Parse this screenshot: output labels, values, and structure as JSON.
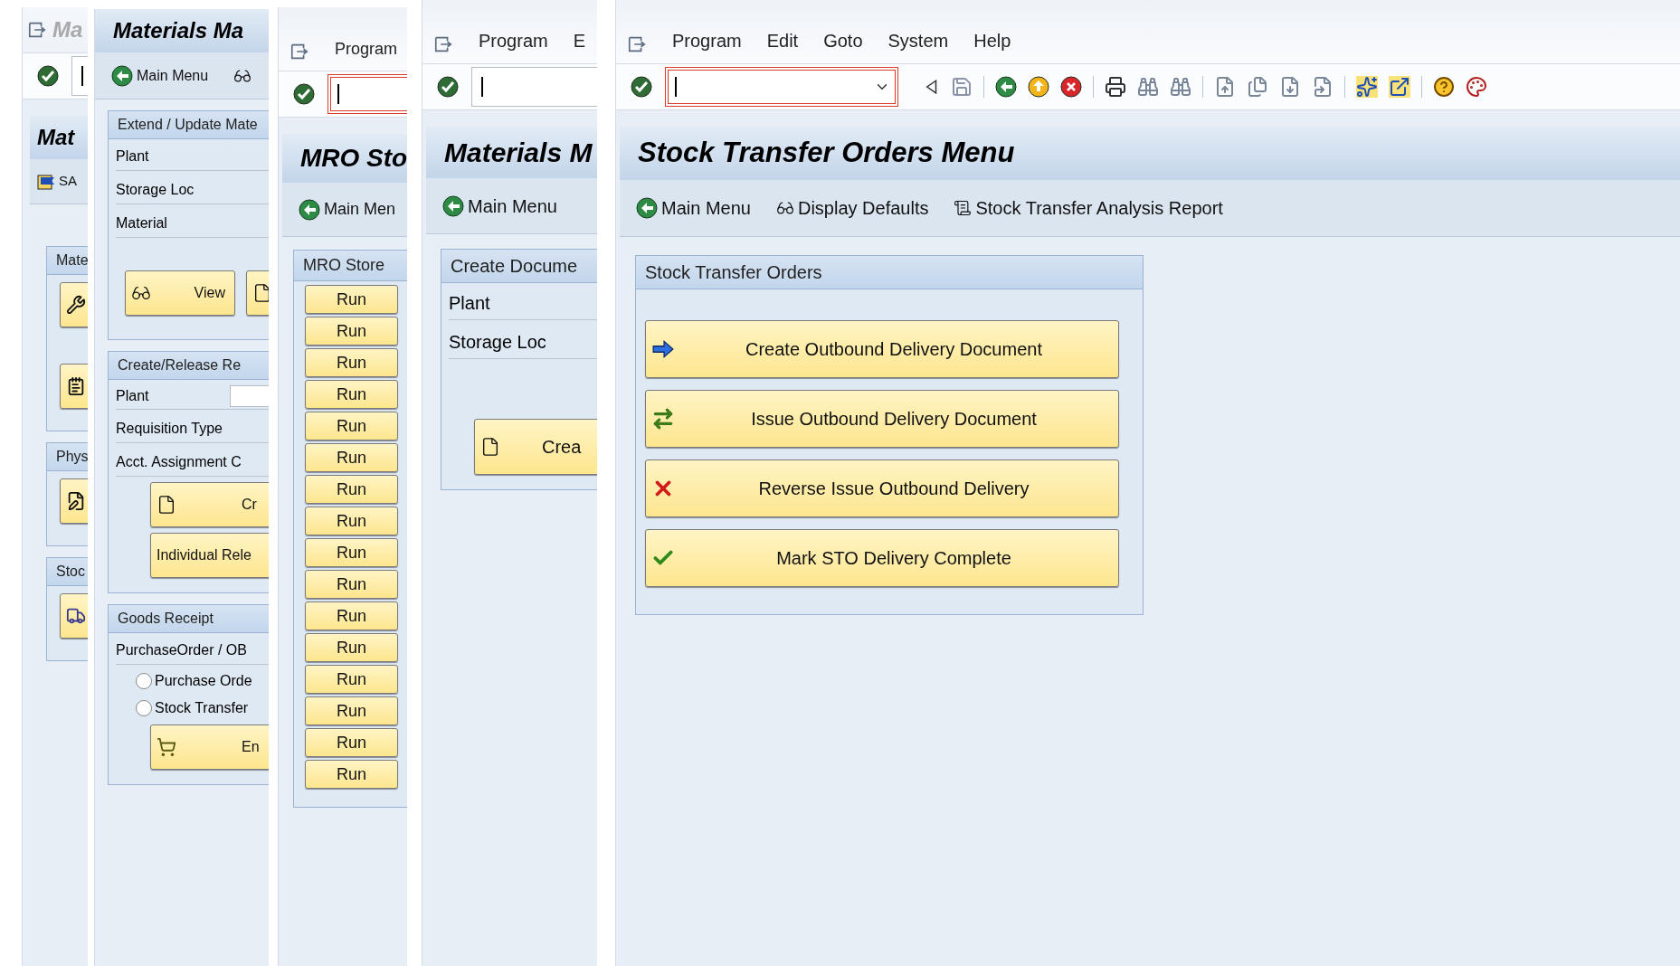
{
  "windows": [
    {
      "header_title": "Ma",
      "command_field": {
        "focused": false
      },
      "title": "Mat",
      "app_toolbar": [
        {
          "kind": "text",
          "label": "SA"
        }
      ],
      "groups": [
        {
          "title": "Mate",
          "items": [
            {
              "kind": "icon_button"
            },
            {
              "kind": "icon_button"
            }
          ]
        },
        {
          "title": "Phys",
          "items": [
            {
              "kind": "icon_button"
            }
          ]
        },
        {
          "title": "Stoc",
          "items": [
            {
              "kind": "icon_button"
            }
          ]
        }
      ]
    },
    {
      "title": "Materials Ma",
      "app_toolbar": [
        {
          "kind": "text",
          "label": "Main Menu"
        },
        {
          "kind": "icon"
        }
      ],
      "groups": [
        {
          "title": "Extend / Update Mate",
          "items": [
            {
              "kind": "label_row",
              "label": "Plant"
            },
            {
              "kind": "label_row",
              "label": "Storage Loc"
            },
            {
              "kind": "label_row",
              "label": "Material"
            },
            {
              "kind": "button_row",
              "buttons": [
                {
                  "kind": "text",
                  "label": "View"
                },
                {
                  "kind": "icon"
                }
              ]
            }
          ]
        },
        {
          "title": "Create/Release Re",
          "items": [
            {
              "kind": "input_row",
              "label": "Plant"
            },
            {
              "kind": "label_row",
              "label": "Requisition Type"
            },
            {
              "kind": "label_row",
              "label": "Acct. Assignment C"
            },
            {
              "kind": "button",
              "label": "Cr"
            },
            {
              "kind": "button",
              "label": "Individual Rele"
            }
          ]
        },
        {
          "title": "Goods Receipt",
          "items": [
            {
              "kind": "label_row",
              "label": "PurchaseOrder / OB"
            },
            {
              "kind": "radio",
              "label": "Purchase Orde",
              "selected": false
            },
            {
              "kind": "radio",
              "label": "Stock Transfer",
              "selected": false
            },
            {
              "kind": "button",
              "label": "En"
            }
          ]
        }
      ]
    },
    {
      "menu": [
        "Program"
      ],
      "command_field": {
        "focused": true
      },
      "title": "MRO Sto",
      "app_toolbar": [
        {
          "kind": "text",
          "label": "Main Men"
        }
      ],
      "groups": [
        {
          "title": "MRO Store",
          "items": [
            {
              "kind": "button",
              "label": "Run"
            },
            {
              "kind": "button",
              "label": "Run"
            },
            {
              "kind": "button",
              "label": "Run"
            },
            {
              "kind": "button",
              "label": "Run"
            },
            {
              "kind": "button",
              "label": "Run"
            },
            {
              "kind": "button",
              "label": "Run"
            },
            {
              "kind": "button",
              "label": "Run"
            },
            {
              "kind": "button",
              "label": "Run"
            },
            {
              "kind": "button",
              "label": "Run"
            },
            {
              "kind": "button",
              "label": "Run"
            },
            {
              "kind": "button",
              "label": "Run"
            },
            {
              "kind": "button",
              "label": "Run"
            },
            {
              "kind": "button",
              "label": "Run"
            },
            {
              "kind": "button",
              "label": "Run"
            },
            {
              "kind": "button",
              "label": "Run"
            },
            {
              "kind": "button",
              "label": "Run"
            }
          ]
        }
      ]
    },
    {
      "menu": [
        "Program",
        "E"
      ],
      "command_field": {
        "focused": false
      },
      "title": "Materials M",
      "app_toolbar": [
        {
          "kind": "text",
          "label": "Main Menu"
        }
      ],
      "groups": [
        {
          "title": "Create Docume",
          "items": [
            {
              "kind": "label_row",
              "label": "Plant"
            },
            {
              "kind": "label_row",
              "label": "Storage Loc"
            },
            {
              "kind": "button",
              "label": "Crea"
            }
          ]
        }
      ]
    },
    {
      "menu": [
        "Program",
        "Edit",
        "Goto",
        "System",
        "Help"
      ],
      "command_field": {
        "focused": true
      },
      "title": "Stock Transfer Orders Menu",
      "app_toolbar": [
        {
          "kind": "text",
          "label": "Main Menu"
        },
        {
          "kind": "text",
          "label": "Display Defaults"
        },
        {
          "kind": "text",
          "label": "Stock Transfer Analysis Report"
        }
      ],
      "groups": [
        {
          "title": "Stock Transfer Orders",
          "items": [
            {
              "kind": "button",
              "label": "Create Outbound Delivery Document"
            },
            {
              "kind": "button",
              "label": "Issue Outbound Delivery Document"
            },
            {
              "kind": "button",
              "label": "Reverse Issue Outbound Delivery"
            },
            {
              "kind": "button",
              "label": "Mark STO Delivery Complete"
            }
          ]
        }
      ]
    }
  ]
}
